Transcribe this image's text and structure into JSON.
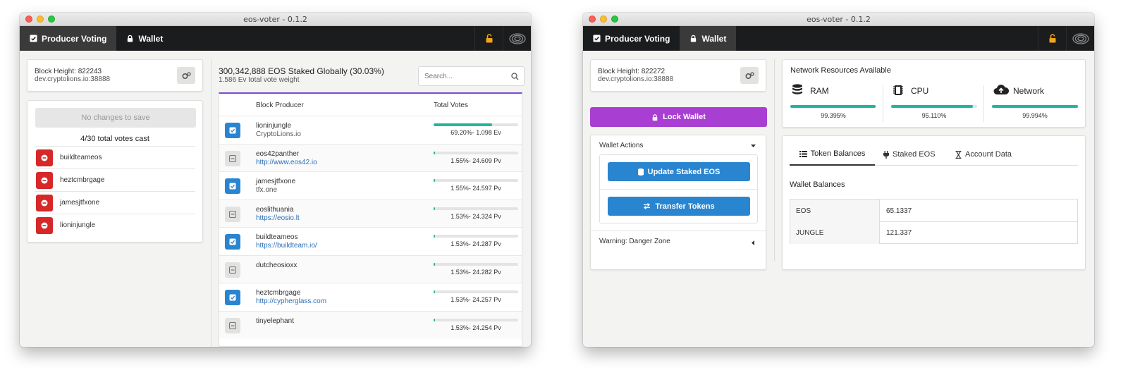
{
  "app": {
    "title": "eos-voter - 0.1.2"
  },
  "nav": {
    "voting_label": "Producer Voting",
    "wallet_label": "Wallet"
  },
  "colors": {
    "accent_blue": "#2a85d0",
    "teal": "#21b5a0",
    "danger": "#d62828",
    "lock_purple": "#a93ed3",
    "lock_icon": "#f2a51a"
  },
  "left": {
    "status": {
      "block_height": "Block Height: 822243",
      "node": "dev.cryptolions.io:38888"
    },
    "save_button": "No changes to save",
    "votes_cast": "4/30 total votes cast",
    "selected": [
      {
        "name": "buildteameos"
      },
      {
        "name": "heztcmbrgage"
      },
      {
        "name": "jamesjtfxone"
      },
      {
        "name": "lioninjungle"
      }
    ],
    "summary": {
      "staked": "300,342,888 EOS Staked Globally (30.03%)",
      "weight": "1.586 Ev total vote weight"
    },
    "search_placeholder": "Search...",
    "table": {
      "col_producer": "Block Producer",
      "col_votes": "Total Votes",
      "rows": [
        {
          "name": "lioninjungle",
          "sub": "CryptoLions.io",
          "link": false,
          "checked": true,
          "vote_fraction": 0.692,
          "label": "69.20%- 1.098 Ev"
        },
        {
          "name": "eos42panther",
          "sub": "http://www.eos42.io",
          "link": true,
          "checked": false,
          "vote_fraction": 0.0155,
          "label": "1.55%- 24.609 Pv"
        },
        {
          "name": "jamesjtfxone",
          "sub": "tfx.one",
          "link": false,
          "checked": true,
          "vote_fraction": 0.0155,
          "label": "1.55%- 24.597 Pv"
        },
        {
          "name": "eoslithuania",
          "sub": "https://eosio.lt",
          "link": true,
          "checked": false,
          "vote_fraction": 0.0153,
          "label": "1.53%- 24.324 Pv"
        },
        {
          "name": "buildteameos",
          "sub": "https://buildteam.io/",
          "link": true,
          "checked": true,
          "vote_fraction": 0.0153,
          "label": "1.53%- 24.287 Pv"
        },
        {
          "name": "dutcheosioxx",
          "sub": "",
          "link": false,
          "checked": false,
          "vote_fraction": 0.0153,
          "label": "1.53%- 24.282 Pv"
        },
        {
          "name": "heztcmbrgage",
          "sub": "http://cypherglass.com",
          "link": true,
          "checked": true,
          "vote_fraction": 0.0153,
          "label": "1.53%- 24.257 Pv"
        },
        {
          "name": "tinyelephant",
          "sub": "",
          "link": false,
          "checked": false,
          "vote_fraction": 0.0153,
          "label": "1.53%- 24.254 Pv"
        }
      ]
    }
  },
  "right": {
    "status": {
      "block_height": "Block Height: 822272",
      "node": "dev.cryptolions.io:38888"
    },
    "lock_label": "Lock Wallet",
    "actions": {
      "title": "Wallet Actions",
      "update_label": "Update Staked EOS",
      "transfer_label": "Transfer Tokens",
      "danger_label": "Warning: Danger Zone"
    },
    "resources": {
      "title": "Network Resources Available",
      "items": [
        {
          "name": "RAM",
          "icon": "database-icon",
          "fraction": 0.99395,
          "pct": "99.395%"
        },
        {
          "name": "CPU",
          "icon": "chip-icon",
          "fraction": 0.9511,
          "pct": "95.110%"
        },
        {
          "name": "Network",
          "icon": "cloud-upload-icon",
          "fraction": 0.99994,
          "pct": "99.994%"
        }
      ]
    },
    "tabs": {
      "balances": "Token Balances",
      "staked": "Staked EOS",
      "account": "Account Data"
    },
    "balances_title": "Wallet Balances",
    "balances": [
      {
        "token": "EOS",
        "amount": "65.1337"
      },
      {
        "token": "JUNGLE",
        "amount": "121.337"
      }
    ]
  }
}
